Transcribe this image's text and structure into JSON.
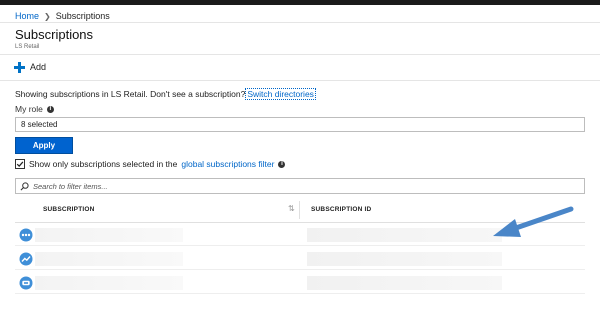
{
  "breadcrumb": {
    "home": "Home",
    "current": "Subscriptions"
  },
  "page": {
    "title": "Subscriptions",
    "subtitle": "LS Retail"
  },
  "toolbar": {
    "add_label": "Add"
  },
  "info": {
    "text": "Showing subscriptions in LS Retail. Don't see a subscription?",
    "switch_link": "Switch directories"
  },
  "role": {
    "label": "My role",
    "selected": "8 selected"
  },
  "apply_label": "Apply",
  "filter": {
    "checked": true,
    "text": "Show only subscriptions selected in the",
    "link": "global subscriptions filter"
  },
  "search": {
    "placeholder": "Search to filter items..."
  },
  "table": {
    "columns": [
      "SUBSCRIPTION",
      "SUBSCRIPTION ID"
    ],
    "rows": [
      {
        "icon": "subscription-key-icon",
        "name": "",
        "id": ""
      },
      {
        "icon": "trend-chart-icon",
        "name": "",
        "id": ""
      },
      {
        "icon": "cloud-subscription-icon",
        "name": "",
        "id": ""
      }
    ]
  },
  "colors": {
    "accent": "#0063cf",
    "link": "#0066c8",
    "arrow": "#4a86c8"
  }
}
